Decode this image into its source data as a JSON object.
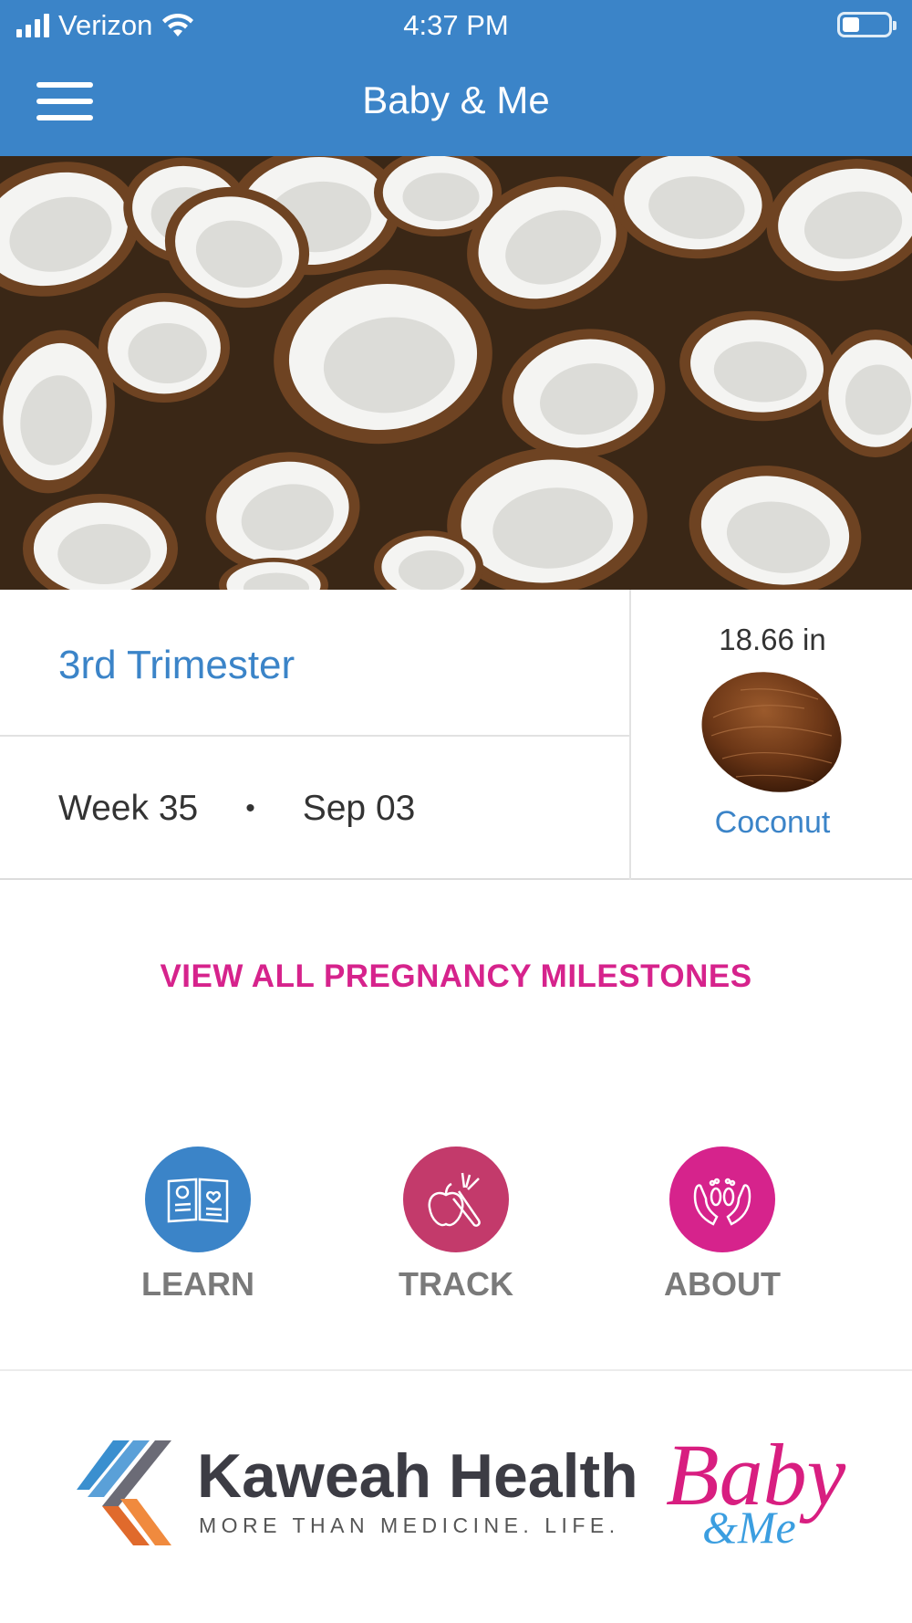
{
  "status_bar": {
    "carrier": "Verizon",
    "time": "4:37 PM"
  },
  "header": {
    "title": "Baby & Me",
    "menu_icon": "hamburger-menu-icon"
  },
  "hero": {
    "image": "halved coconuts photo"
  },
  "pregnancy": {
    "trimester": "3rd Trimester",
    "week": "Week 35",
    "separator": "•",
    "date": "Sep 03",
    "baby_size": "18.66 in",
    "fruit_name": "Coconut"
  },
  "milestones_link": "VIEW ALL PREGNANCY MILESTONES",
  "actions": [
    {
      "label": "LEARN",
      "icon": "book-baby-icon",
      "color": "#3b84c8"
    },
    {
      "label": "TRACK",
      "icon": "fruit-vegetable-icon",
      "color": "#c33a6b"
    },
    {
      "label": "ABOUT",
      "icon": "hands-feet-icon",
      "color": "#d6238c"
    }
  ],
  "footer": {
    "kaweah_name": "Kaweah Health",
    "kaweah_tagline": "MORE THAN MEDICINE. LIFE.",
    "babyme_logo_top": "Baby",
    "babyme_logo_bottom": "&Me"
  },
  "colors": {
    "brand_blue": "#3b84c8",
    "accent_pink": "#d6238c",
    "track_red": "#c33a6b"
  }
}
